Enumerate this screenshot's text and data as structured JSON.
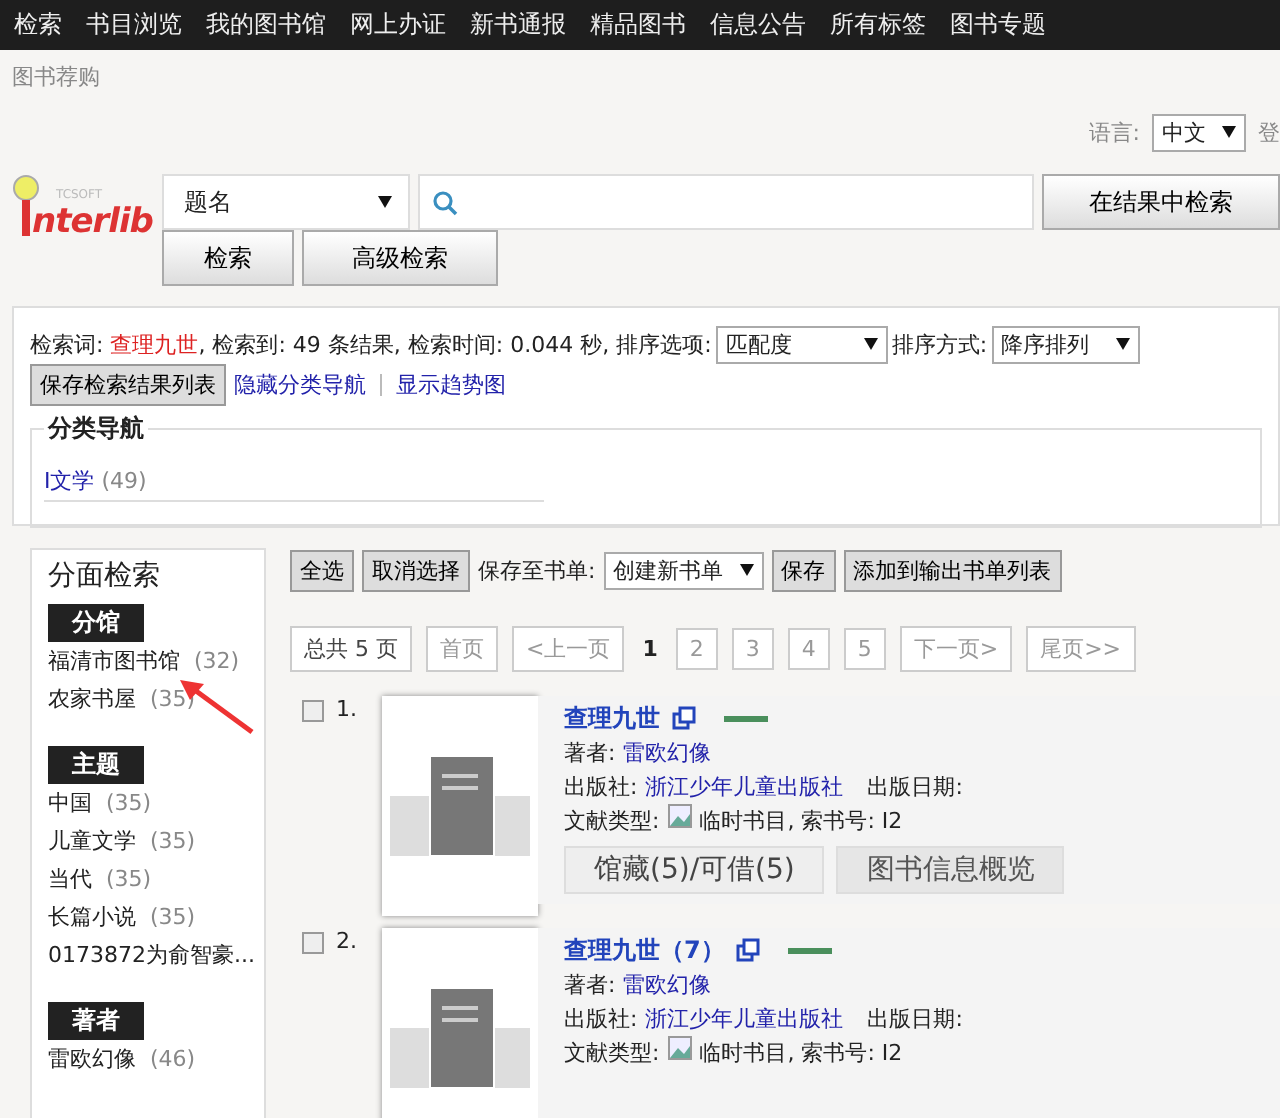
{
  "nav": [
    {
      "label": "检索"
    },
    {
      "label": "书目浏览"
    },
    {
      "label": "我的图书馆"
    },
    {
      "label": "网上办证"
    },
    {
      "label": "新书通报"
    },
    {
      "label": "精品图书"
    },
    {
      "label": "信息公告"
    },
    {
      "label": "所有标签"
    },
    {
      "label": "图书专题"
    }
  ],
  "breadcrumb": "图书荐购",
  "language": {
    "label": "语言:",
    "value": "中文",
    "login": "登"
  },
  "logo": {
    "tagline": "TCSOFT",
    "wordmark": "nterlib"
  },
  "search": {
    "field": "题名",
    "button_within": "在结果中检索",
    "buttons": [
      "检索",
      "高级检索"
    ]
  },
  "summary": {
    "term_label": "检索词:",
    "term": "查理九世",
    "found_label": ", 检索到:",
    "count": "49",
    "count_unit": "条结果,",
    "time_label": "检索时间:",
    "time": "0.044",
    "time_unit": "秒,",
    "sort_label": "排序选项:",
    "sort": "匹配度",
    "order_label": "排序方式:",
    "order": "降序排列",
    "save_button": "保存检索结果列表",
    "links": [
      "隐藏分类导航",
      "显示趋势图"
    ]
  },
  "category_nav": {
    "title": "分类导航",
    "items": [
      {
        "name": "I文学",
        "count": "(49)"
      }
    ]
  },
  "facets": {
    "title": "分面检索",
    "groups": [
      {
        "heading": "分馆",
        "items": [
          {
            "name": "福清市图书馆",
            "count": "(32)"
          },
          {
            "name": "农家书屋",
            "count": "(35)"
          }
        ]
      },
      {
        "heading": "主题",
        "items": [
          {
            "name": "中国",
            "count": "(35)"
          },
          {
            "name": "儿童文学",
            "count": "(35)"
          },
          {
            "name": "当代",
            "count": "(35)"
          },
          {
            "name": "长篇小说",
            "count": "(35)"
          },
          {
            "name": "0173872为俞智豪..."
          }
        ]
      },
      {
        "heading": "著者",
        "items": [
          {
            "name": "雷欧幻像",
            "count": "(46)"
          }
        ]
      }
    ]
  },
  "toolbar": {
    "select_all": "全选",
    "deselect": "取消选择",
    "save_to_label": "保存至书单:",
    "list": "创建新书单",
    "save": "保存",
    "add": "添加到输出书单列表"
  },
  "pagination": {
    "total": "总共 5 页",
    "first": "首页",
    "prev": "<上一页",
    "pages": [
      {
        "label": "1",
        "selected": true
      },
      {
        "label": "2",
        "selected": false
      },
      {
        "label": "3",
        "selected": false
      },
      {
        "label": "4",
        "selected": false
      },
      {
        "label": "5",
        "selected": false
      }
    ],
    "next": "下一页>",
    "last": "尾页>>"
  },
  "results": [
    {
      "number": "1.",
      "checked": false,
      "title": "查理九世",
      "author_label": "著者:",
      "author": "雷欧幻像",
      "publisher_label": "出版社:",
      "publisher": "浙江少年儿童出版社",
      "date_label": "出版日期:",
      "type_label": "文献类型:",
      "type": "临时书目, 索书号: I2",
      "tabs": [
        {
          "label": "馆藏(5)/可借(5)",
          "selected": true
        },
        {
          "label": "图书信息概览",
          "selected": false
        }
      ]
    },
    {
      "number": "2.",
      "checked": false,
      "title": "查理九世（7）",
      "author_label": "著者:",
      "author": "雷欧幻像",
      "publisher_label": "出版社:",
      "publisher": "浙江少年儿童出版社",
      "date_label": "出版日期:",
      "type_label": "文献类型:",
      "type": "临时书目, 索书号: I2"
    }
  ]
}
